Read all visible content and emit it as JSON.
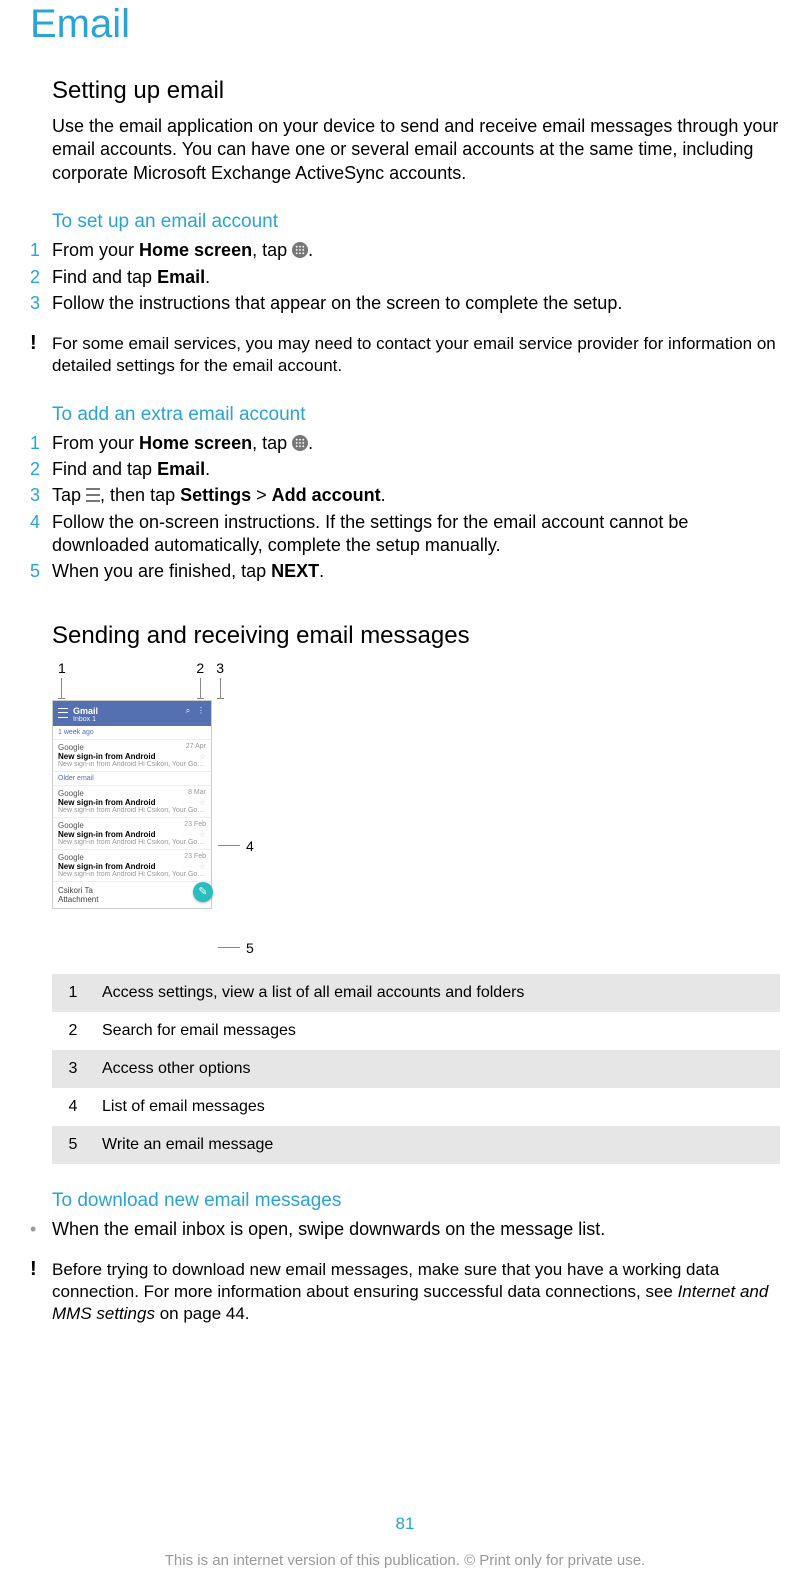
{
  "chapter_title": "Email",
  "section1": {
    "title": "Setting up email",
    "intro": "Use the email application on your device to send and receive email messages through your email accounts. You can have one or several email accounts at the same time, including corporate Microsoft Exchange ActiveSync accounts.",
    "sub1": {
      "title": "To set up an email account",
      "steps": {
        "n1": "1",
        "s1a": "From your ",
        "s1b": "Home screen",
        "s1c": ", tap ",
        "s1d": ".",
        "n2": "2",
        "s2a": "Find and tap ",
        "s2b": "Email",
        "s2c": ".",
        "n3": "3",
        "s3": "Follow the instructions that appear on the screen to complete the setup."
      },
      "note": "For some email services, you may need to contact your email service provider for information on detailed settings for the email account."
    },
    "sub2": {
      "title": "To add an extra email account",
      "steps": {
        "n1": "1",
        "s1a": "From your ",
        "s1b": "Home screen",
        "s1c": ", tap ",
        "s1d": ".",
        "n2": "2",
        "s2a": "Find and tap ",
        "s2b": "Email",
        "s2c": ".",
        "n3": "3",
        "s3a": "Tap ",
        "s3b": ", then tap ",
        "s3c": "Settings",
        "s3d": " > ",
        "s3e": "Add account",
        "s3f": ".",
        "n4": "4",
        "s4": "Follow the on-screen instructions. If the settings for the email account cannot be downloaded automatically, complete the setup manually.",
        "n5": "5",
        "s5a": "When you are finished, tap ",
        "s5b": "NEXT",
        "s5c": "."
      }
    }
  },
  "section2": {
    "title": "Sending and receiving email messages",
    "callouts": {
      "c1": "1",
      "c2": "2",
      "c3": "3",
      "c4": "4",
      "c5": "5"
    },
    "phone": {
      "app_title": "Gmail",
      "app_sub": "Inbox 1",
      "grp1": "1 week ago",
      "m1_from": "Google",
      "m1_date": "27 Apr",
      "m1_subj": "New sign-in from Android",
      "m1_prev": "New sign-in from Android Hi Csikori, Your Google A…",
      "grp2": "Older email",
      "m2_from": "Google",
      "m2_date": "8 Mar",
      "m2_subj": "New sign-in from Android",
      "m2_prev": "New sign-in from Android Hi Csikori, Your Google A…",
      "m3_from": "Google",
      "m3_date": "23 Feb",
      "m3_subj": "New sign-in from Android",
      "m3_prev": "New sign-in from Android Hi Csikori, Your Google A…",
      "m4_from": "Google",
      "m4_date": "23 Feb",
      "m4_subj": "New sign-in from Android",
      "m4_prev": "New sign-in from Android Hi Csikori, Your Google A",
      "att_from": "Csikori Ta",
      "att_label": "Attachment"
    },
    "legend": {
      "r1n": "1",
      "r1": "Access settings, view a list of all email accounts and folders",
      "r2n": "2",
      "r2": "Search for email messages",
      "r3n": "3",
      "r3": "Access other options",
      "r4n": "4",
      "r4": "List of email messages",
      "r5n": "5",
      "r5": "Write an email message"
    },
    "sub3": {
      "title": "To download new email messages",
      "bullet": "When the email inbox is open, swipe downwards on the message list.",
      "note_a": "Before trying to download new email messages, make sure that you have a working data connection. For more information about ensuring successful data connections, see ",
      "note_b": "Internet and MMS settings",
      "note_c": " on page 44."
    }
  },
  "footer": {
    "page": "81",
    "legal": "This is an internet version of this publication. © Print only for private use."
  }
}
